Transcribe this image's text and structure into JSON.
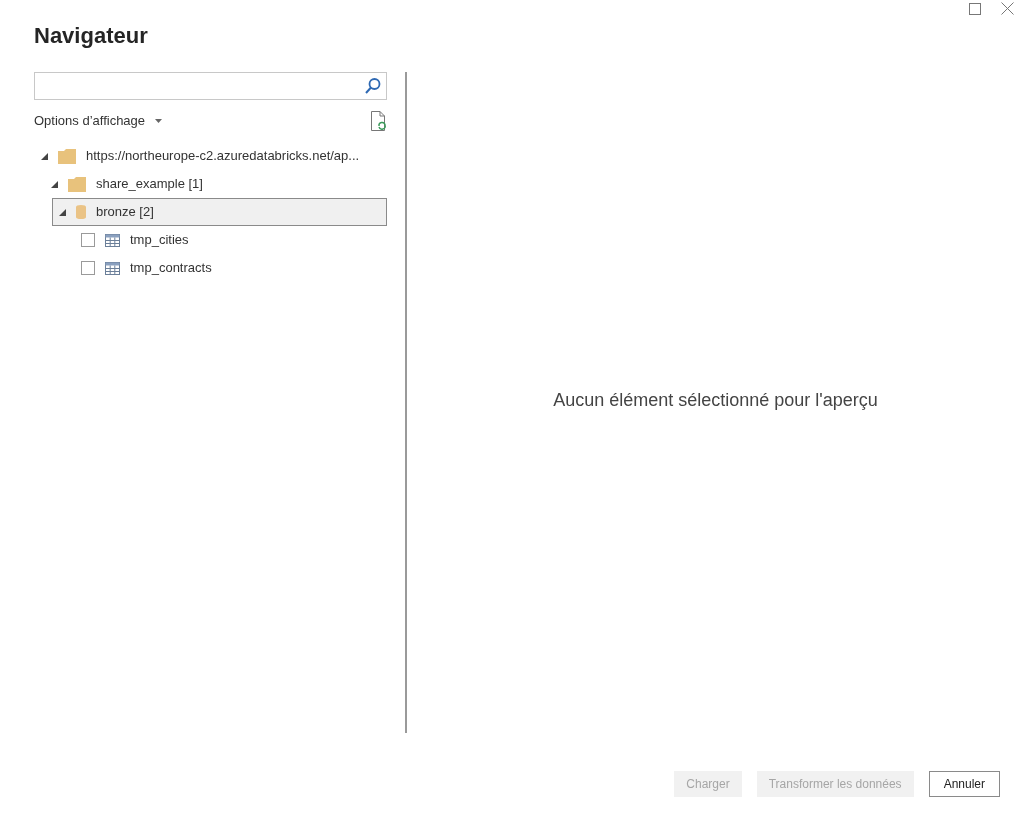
{
  "window": {
    "title": "Navigateur"
  },
  "view_options": {
    "label": "Options d’affichage"
  },
  "tree": [
    {
      "label": "https://northeurope-c2.azuredatabricks.net/ap...",
      "kind": "folder",
      "expanded": true,
      "selected": false,
      "children": [
        {
          "label": "share_example [1]",
          "kind": "folder",
          "expanded": true,
          "selected": false,
          "children": [
            {
              "label": "bronze [2]",
              "kind": "database",
              "expanded": true,
              "selected": true,
              "children": [
                {
                  "label": "tmp_cities",
                  "kind": "table",
                  "checked": false,
                  "selected": false
                },
                {
                  "label": "tmp_contracts",
                  "kind": "table",
                  "checked": false,
                  "selected": false
                }
              ]
            }
          ]
        }
      ]
    }
  ],
  "preview": {
    "message": "Aucun élément sélectionné pour l'aperçu"
  },
  "buttons": [
    {
      "label": "Charger",
      "disabled": true
    },
    {
      "label": "Transformer les données",
      "disabled": true
    },
    {
      "label": "Annuler",
      "disabled": false
    }
  ]
}
